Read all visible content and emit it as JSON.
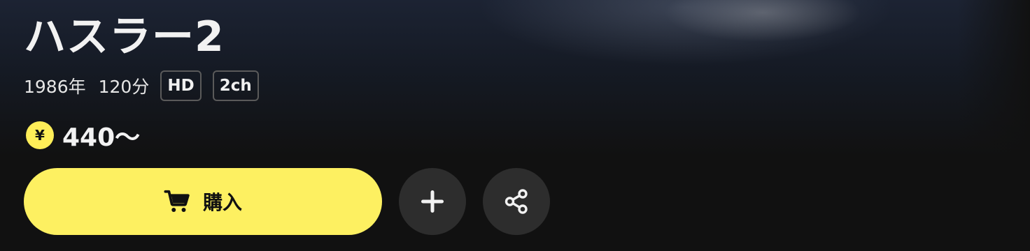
{
  "title": "ハスラー2",
  "meta": {
    "year": "1986年",
    "duration": "120分",
    "tags": [
      "HD",
      "2ch"
    ]
  },
  "price": {
    "currency_symbol": "¥",
    "value": "440〜"
  },
  "actions": {
    "buy_label": "購入",
    "icons": {
      "buy": "cart-icon",
      "add": "plus-icon",
      "share": "share-icon",
      "price": "yen-icon"
    }
  },
  "colors": {
    "accent": "#fdf061",
    "background": "#111111",
    "secondary_button": "#2d2d2d",
    "tag_border": "#5a5a5a"
  }
}
